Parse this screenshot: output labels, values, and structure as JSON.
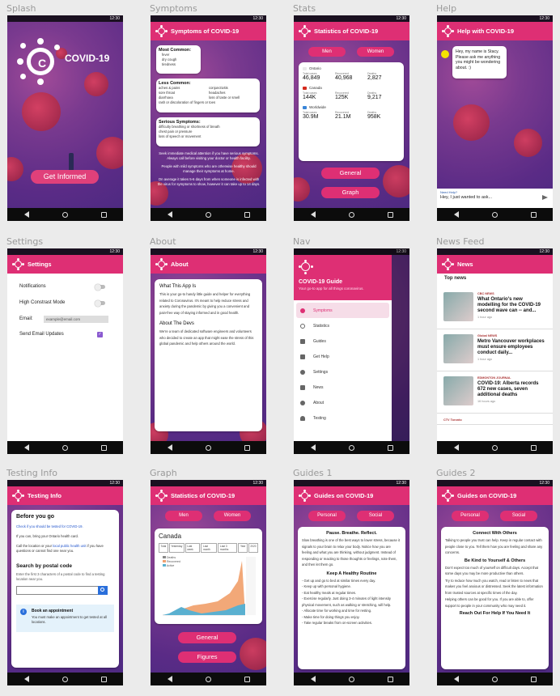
{
  "labels": {
    "splash": "Splash",
    "symptoms": "Symptoms",
    "stats": "Stats",
    "help": "Help",
    "settings": "Settings",
    "about": "About",
    "nav": "Nav",
    "news": "News Feed",
    "testing": "Testing Info",
    "graph": "Graph",
    "guides1": "Guides 1",
    "guides2": "Guides 2"
  },
  "status_time": "12:30",
  "splash": {
    "brand": "COVID-19",
    "button": "Get Informed"
  },
  "symptoms": {
    "title": "Symptoms of COVID-19",
    "most_common_h": "Most Common:",
    "most_common": [
      "fever",
      "dry cough",
      "tiredness"
    ],
    "less_common_h": "Less Common:",
    "less_common_left": [
      "aches & pains",
      "sore throat",
      "diarrhoea",
      "rash or discoloration of fingers or toes"
    ],
    "less_common_right": [
      "conjunctivitis",
      "headaches",
      "loss of taste or smell"
    ],
    "serious_h": "Serious Symptoms:",
    "serious": [
      "difficulty breathing or shortness of breath",
      "chest pain or pressure",
      "loss of speech or movement"
    ],
    "note1": "Seek immediate medical attention if you have serious symptoms. Always call before visiting your doctor or health facility.",
    "note2": "People with mild symptoms who are otherwise healthy should manage their symptoms at home.",
    "note3": "On average it takes 5-6 days from when someone is infected with the virus for symptoms to show, however it can take up to 14 days."
  },
  "stats": {
    "title": "Statistics of COVID-19",
    "tab_men": "Men",
    "tab_women": "Women",
    "regions": [
      {
        "name": "Ontario",
        "total_label": "Total cases",
        "total": "46,849",
        "rec_label": "Recovered",
        "rec": "40,968",
        "death_label": "Deaths",
        "death": "2,827"
      },
      {
        "name": "Canada",
        "total_label": "Total cases",
        "total": "144K",
        "rec_label": "Recovered",
        "rec": "125K",
        "death_label": "Deaths",
        "death": "9,217"
      },
      {
        "name": "Worldwide",
        "total_label": "Total cases",
        "total": "30.9M",
        "rec_label": "Recovered",
        "rec": "21.1M",
        "death_label": "Deaths",
        "death": "958K"
      }
    ],
    "btn_general": "General",
    "btn_graph": "Graph"
  },
  "help": {
    "title": "Help with COVID-19",
    "bubble": "Hey, my name is Stacy. Please ask me anything you might be wondering about. :)",
    "input_label": "Need Help?",
    "input_value": "Hey, I just wanted to ask..."
  },
  "settings": {
    "title": "Settings",
    "notifications": "Notifications",
    "contrast": "High Constrast Mode",
    "email_label": "Email:",
    "email_value": "example@email.com",
    "updates": "Send Email Updates"
  },
  "about": {
    "title": "About",
    "h1": "What This App Is",
    "p1": "This is your go-to handy little guide and helper for everything related to Coronavirus. It's meant to help reduce stress and anxiety during the pandemic by giving you a convenient and pain-free way of staying informed and in good health.",
    "h2": "About The Devs",
    "p2": "We're a team of dedicated software engineers and volunteers who decided to create an app that might ease the stress of this global pandemic and help others around the world."
  },
  "nav": {
    "title": "COVID-19 Guide",
    "subtitle": "Your go-to app for all things coronavirus.",
    "items": [
      "Symptoms",
      "Statistics",
      "Guides",
      "Get Help",
      "Settings",
      "News",
      "About",
      "Testing"
    ]
  },
  "news": {
    "title": "News",
    "section": "Top news",
    "items": [
      {
        "source": "CBC NEWS",
        "headline": "What Ontario's new modelling for the COVID-19 second wave can -- and...",
        "time": "1 hour ago"
      },
      {
        "source": "Global NEWS",
        "headline": "Metro Vancouver workplaces must ensure employees conduct daily...",
        "time": "1 hour ago"
      },
      {
        "source": "EDMONTON JOURNAL",
        "headline": "COVID-19: Alberta records 672 new cases, seven additional deaths",
        "time": "16 hours ago"
      },
      {
        "source": "CTV Toronto",
        "headline": "",
        "time": ""
      }
    ]
  },
  "testing": {
    "title": "Testing Info",
    "h1": "Before you go",
    "link1": "Check if you should be tested for COVID-19.",
    "p1": "If you can, bring your Ontario health card.",
    "p2a": "Call the location or your ",
    "p2link": "local public health unit",
    "p2b": " if you have questions or cannot find one near you.",
    "h2": "Search by postal code",
    "p3": "Enter the first 3 characters of a postal code to find a testing location near you.",
    "appt_h": "Book an appointment",
    "appt_p": "You must make an appointment to get tested at all locations."
  },
  "graph": {
    "title": "Statistics of COVID-19",
    "tab_men": "Men",
    "tab_women": "Women",
    "region": "Canada",
    "ranges": [
      "Total",
      "Yesterday",
      "Last week",
      "Last month",
      "Last 3 months",
      "Year",
      "2020"
    ],
    "legend": [
      "Deaths",
      "Recovered",
      "Active"
    ],
    "btn_general": "General",
    "btn_figures": "Figures"
  },
  "guides1": {
    "title": "Guides on COVID-19",
    "tab1": "Personal",
    "tab2": "Social",
    "h1": "Pause. Breathe. Reflect.",
    "p1": "Slow breathing is one of the best ways to lower stress, because it signals to your brain to relax your body. Notice how you are feeling and what you are thinking, without judgment. Instead of responding or reacting to those thoughts or feelings, note them, and then let them go.",
    "h2": "Keep A Healthy Routine",
    "p2": [
      "- Get up and go to bed at similar times every day.",
      "- Keep up with personal hygiene.",
      "- Eat healthy meals at regular times.",
      "- Exercise regularly. Just doing 3-4 minutes of light intensity physical movement, such as walking or stretching, will help.",
      "- Allocate time for working and time for resting.",
      "- Make time for doing things you enjoy.",
      "- Take regular breaks from on-screen activities."
    ]
  },
  "guides2": {
    "title": "Guides on COVID-19",
    "tab1": "Personal",
    "tab2": "Social",
    "h1": "Connect With Others",
    "p1": "Talking to people you trust can help. Keep in regular contact with people close to you. Tell them how you are feeling and share any concerns.",
    "h2": "Be Kind to Yourself & Others",
    "p2": "Don't expect too much of yourself on difficult days. Accept that some days you may be more productive than others.",
    "p3": "Try to reduce how much you watch, read or listen to news that makes you feel anxious or distressed. Seek the latest information from trusted sources at specific times of the day.",
    "p4": "Helping others can be good for you. If you are able to, offer support to people in your community who may need it.",
    "h3": "Reach Out For Help If You Need It"
  },
  "colors": {
    "accent": "#de2f74",
    "purple": "#5a2b86"
  }
}
